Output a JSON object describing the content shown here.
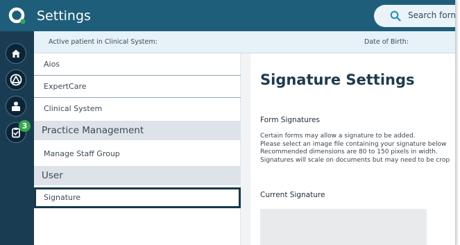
{
  "header": {
    "title": "Settings",
    "search": {
      "placeholder": "Search forms",
      "icon": "search-icon"
    }
  },
  "rail": {
    "items": [
      {
        "name": "home",
        "icon": "home-icon"
      },
      {
        "name": "alerts",
        "icon": "triangle-alert-icon"
      },
      {
        "name": "user",
        "icon": "user-icon"
      },
      {
        "name": "tasks",
        "icon": "clipboard-check-icon",
        "badge": "3"
      }
    ]
  },
  "patient_bar": {
    "active_patient_label": "Active patient in Clinical System:",
    "dob_label": "Date of Birth:"
  },
  "nav": {
    "items": [
      {
        "label": "Aios",
        "type": "item"
      },
      {
        "label": "ExpertCare",
        "type": "item"
      },
      {
        "label": "Clinical System",
        "type": "item"
      },
      {
        "label": "Practice Management",
        "type": "header"
      },
      {
        "label": "Manage Staff Group",
        "type": "item"
      },
      {
        "label": "User",
        "type": "header"
      },
      {
        "label": "Signature",
        "type": "item",
        "selected": true
      }
    ]
  },
  "main": {
    "title": "Signature Settings",
    "form_signatures": {
      "heading": "Form Signatures",
      "lines": [
        "Certain forms may allow a signature to be added.",
        "Please select an image file containing your signature below",
        "Recommended dimensions are 80 to 150 pixels in width.",
        "Signatures will scale on documents but may need to be crop"
      ]
    },
    "current_signature": {
      "heading": "Current Signature"
    }
  },
  "colors": {
    "topbar": "#1f5e7a",
    "rail": "#1a3c52",
    "accent_green": "#35a84a",
    "selected_border": "#13394f"
  }
}
